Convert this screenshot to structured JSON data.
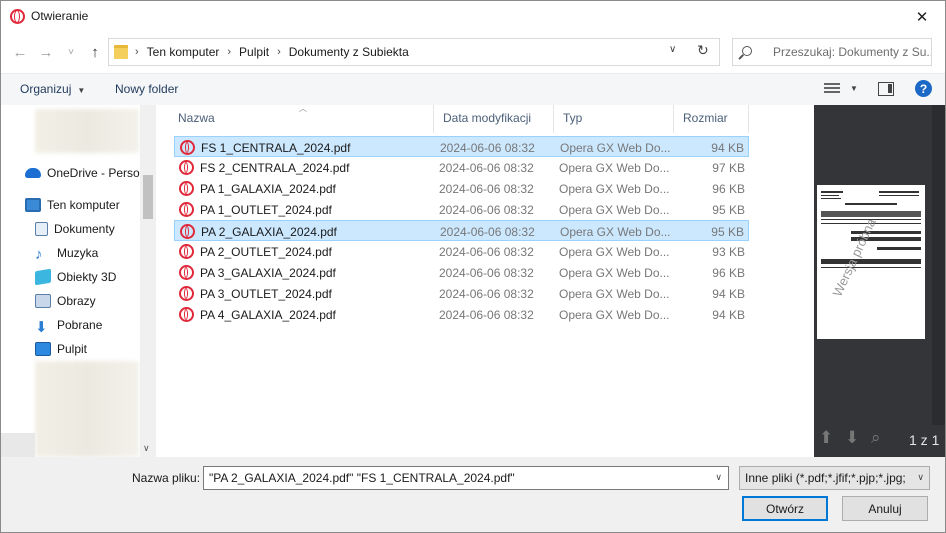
{
  "window": {
    "title": "Otwieranie"
  },
  "nav": {
    "back": "←",
    "forward": "→",
    "recent": "˅",
    "up": "↑",
    "breadcrumbs": [
      "Ten komputer",
      "Pulpit",
      "Dokumenty z Subiekta"
    ],
    "search_placeholder": "Przeszukaj: Dokumenty z Su..."
  },
  "toolbar": {
    "organize": "Organizuj",
    "new_folder": "Nowy folder"
  },
  "sidebar": {
    "items": [
      {
        "label": "OneDrive - Persor",
        "icon": "onedrive-icon"
      },
      {
        "label": "Ten komputer",
        "icon": "computer-icon"
      },
      {
        "label": "Dokumenty",
        "icon": "documents-icon"
      },
      {
        "label": "Muzyka",
        "icon": "music-icon"
      },
      {
        "label": "Obiekty 3D",
        "icon": "3d-objects-icon"
      },
      {
        "label": "Obrazy",
        "icon": "pictures-icon"
      },
      {
        "label": "Pobrane",
        "icon": "downloads-icon"
      },
      {
        "label": "Pulpit",
        "icon": "desktop-icon"
      }
    ]
  },
  "columns": {
    "name": "Nazwa",
    "date": "Data modyfikacji",
    "type": "Typ",
    "size": "Rozmiar"
  },
  "files": [
    {
      "name": "FS 1_CENTRALA_2024.pdf",
      "date": "2024-06-06 08:32",
      "type": "Opera GX Web Do...",
      "size": "94 KB",
      "selected": true
    },
    {
      "name": "FS 2_CENTRALA_2024.pdf",
      "date": "2024-06-06 08:32",
      "type": "Opera GX Web Do...",
      "size": "97 KB",
      "selected": false
    },
    {
      "name": "PA 1_GALAXIA_2024.pdf",
      "date": "2024-06-06 08:32",
      "type": "Opera GX Web Do...",
      "size": "96 KB",
      "selected": false
    },
    {
      "name": "PA 1_OUTLET_2024.pdf",
      "date": "2024-06-06 08:32",
      "type": "Opera GX Web Do...",
      "size": "95 KB",
      "selected": false
    },
    {
      "name": "PA 2_GALAXIA_2024.pdf",
      "date": "2024-06-06 08:32",
      "type": "Opera GX Web Do...",
      "size": "95 KB",
      "selected": true
    },
    {
      "name": "PA 2_OUTLET_2024.pdf",
      "date": "2024-06-06 08:32",
      "type": "Opera GX Web Do...",
      "size": "93 KB",
      "selected": false
    },
    {
      "name": "PA 3_GALAXIA_2024.pdf",
      "date": "2024-06-06 08:32",
      "type": "Opera GX Web Do...",
      "size": "96 KB",
      "selected": false
    },
    {
      "name": "PA 3_OUTLET_2024.pdf",
      "date": "2024-06-06 08:32",
      "type": "Opera GX Web Do...",
      "size": "94 KB",
      "selected": false
    },
    {
      "name": "PA 4_GALAXIA_2024.pdf",
      "date": "2024-06-06 08:32",
      "type": "Opera GX Web Do...",
      "size": "94 KB",
      "selected": false
    }
  ],
  "preview": {
    "watermark": "Wersja próbna",
    "page_count": "1 z 1"
  },
  "footer": {
    "filename_label": "Nazwa pliku:",
    "filename_value": "\"PA 2_GALAXIA_2024.pdf\" \"FS 1_CENTRALA_2024.pdf\"",
    "filetype": "Inne pliki (*.pdf;*.jfif;*.pjp;*.jpg;",
    "open": "Otwórz",
    "cancel": "Anuluj"
  },
  "colors": {
    "accent": "#0078d7",
    "selection": "#cce8ff",
    "opera": "#e0283a"
  }
}
